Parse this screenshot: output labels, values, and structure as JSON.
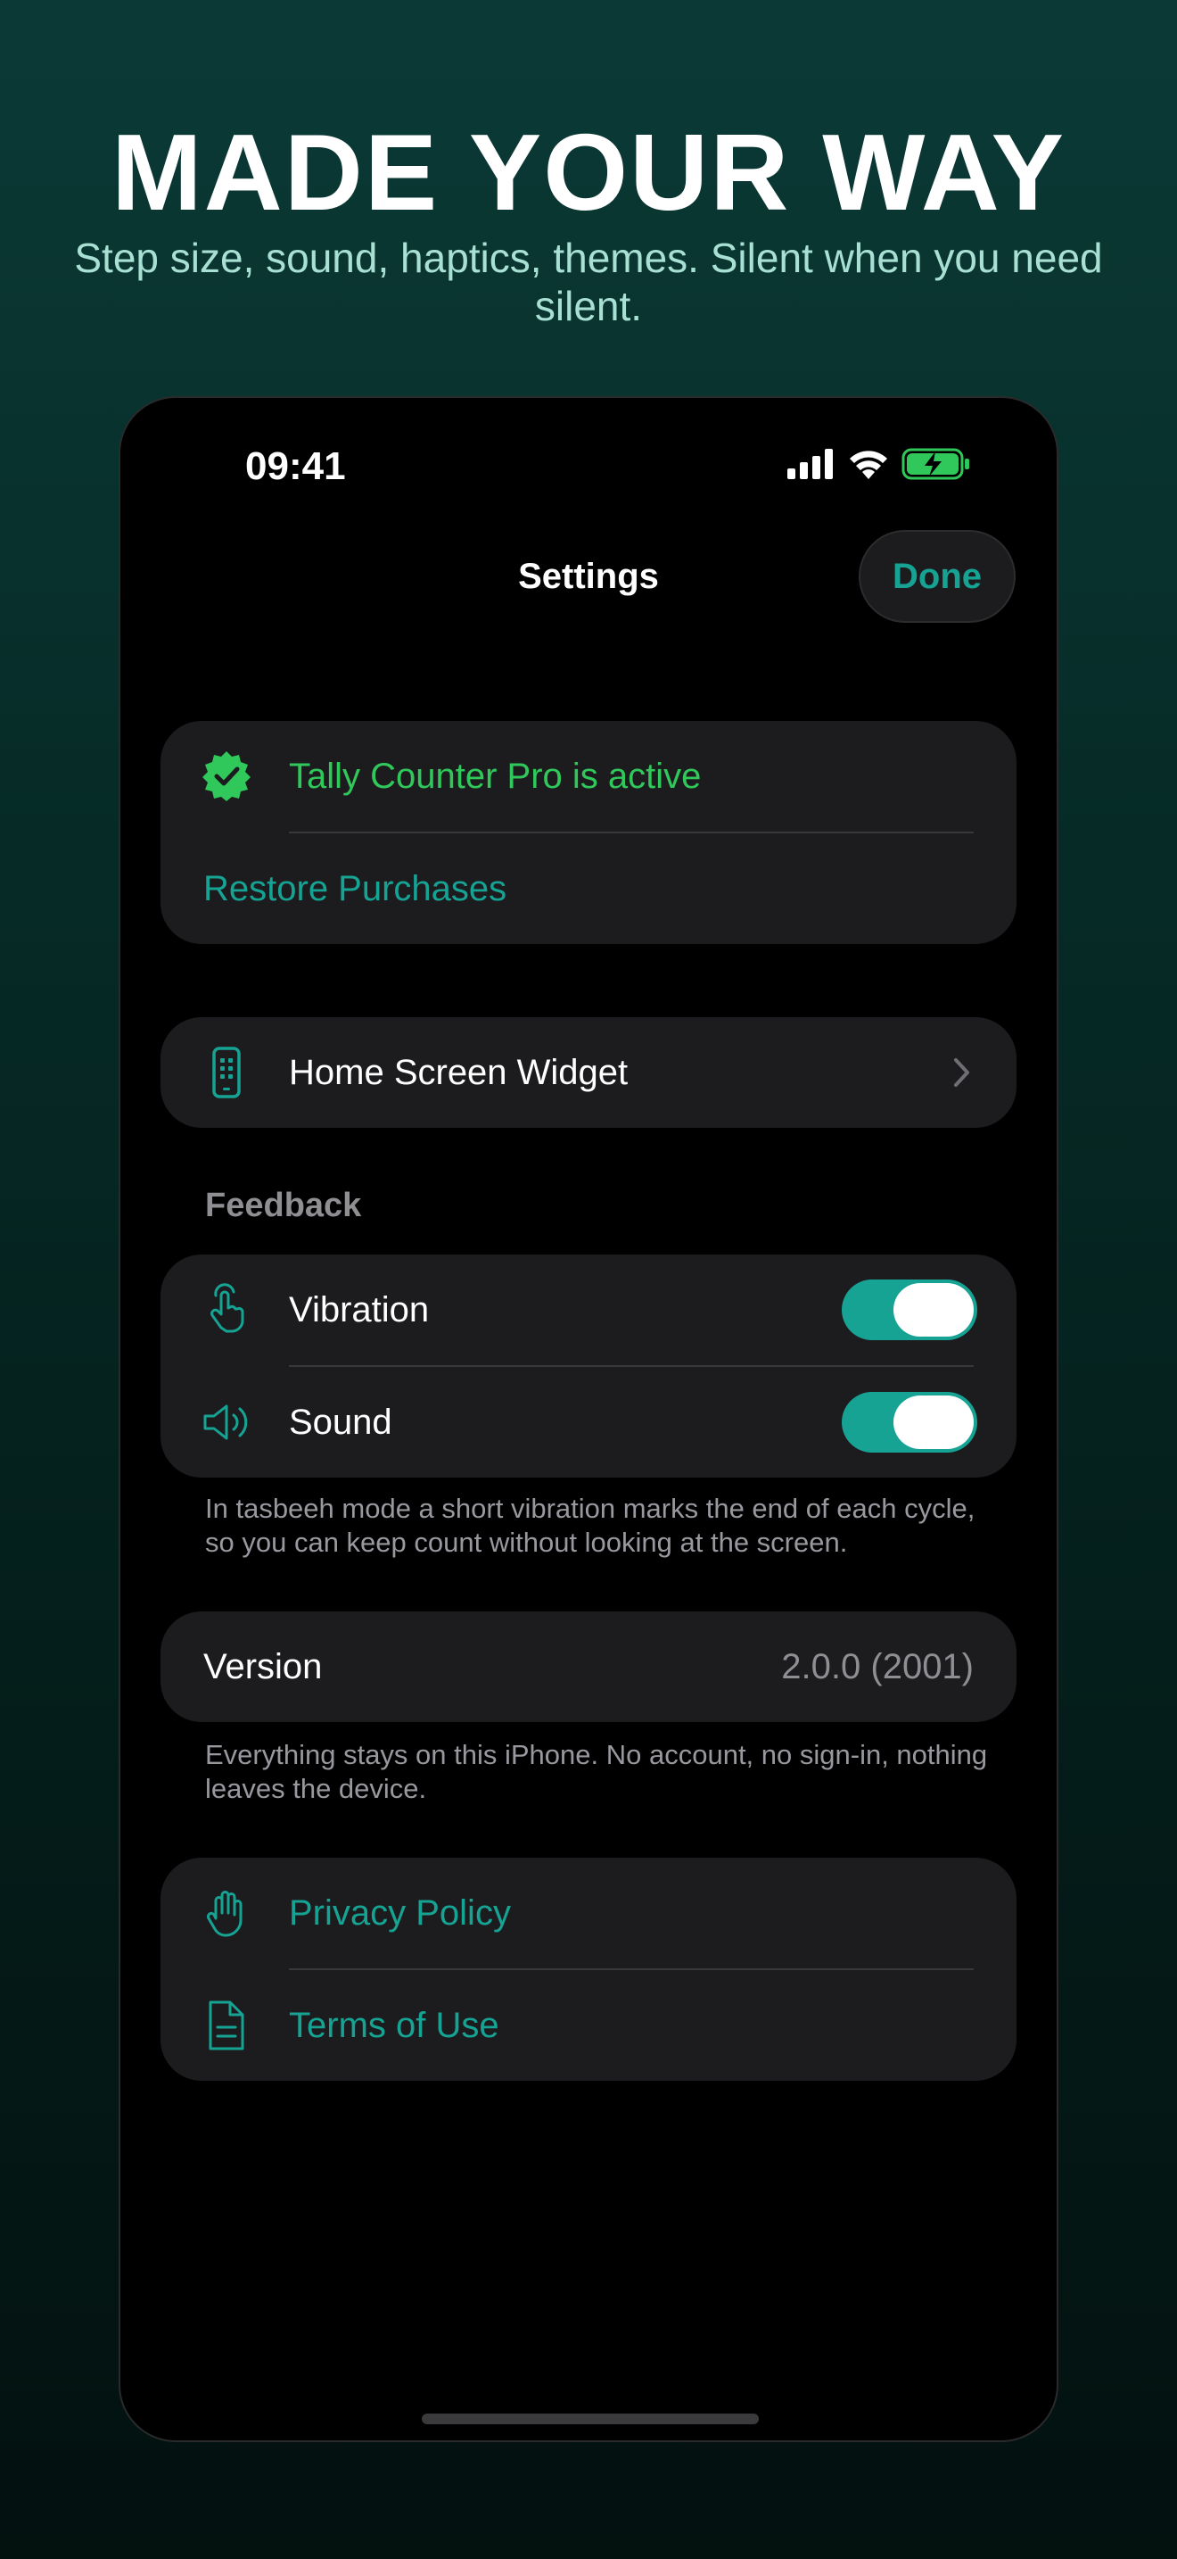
{
  "hero": {
    "title": "MADE YOUR WAY",
    "subtitle": "Step size, sound, haptics, themes. Silent when you need silent."
  },
  "status_bar": {
    "time": "09:41",
    "icons": [
      "cellular-signal-icon",
      "wifi-icon",
      "battery-charging-icon"
    ]
  },
  "nav": {
    "title": "Settings",
    "done_label": "Done"
  },
  "pro": {
    "status_label": "Tally Counter Pro is active",
    "restore_label": "Restore Purchases",
    "icon": "verified-badge-icon"
  },
  "widget": {
    "label": "Home Screen Widget",
    "icon": "widget-phone-icon"
  },
  "feedback": {
    "header": "Feedback",
    "vibration": {
      "label": "Vibration",
      "on": true,
      "icon": "hand-tap-icon"
    },
    "sound": {
      "label": "Sound",
      "on": true,
      "icon": "speaker-icon"
    },
    "footnote": "In tasbeeh mode a short vibration marks the end of each cycle, so you can keep count without looking at the screen."
  },
  "version": {
    "label": "Version",
    "value": "2.0.0 (2001)",
    "footnote": "Everything stays on this iPhone. No account, no sign-in, nothing leaves the device."
  },
  "legal": {
    "privacy_label": "Privacy Policy",
    "terms_label": "Terms of Use",
    "privacy_icon": "raised-hand-icon",
    "terms_icon": "document-icon"
  },
  "colors": {
    "accent": "#16a394",
    "success": "#30c85a",
    "cell_background": "#1c1c1e"
  }
}
